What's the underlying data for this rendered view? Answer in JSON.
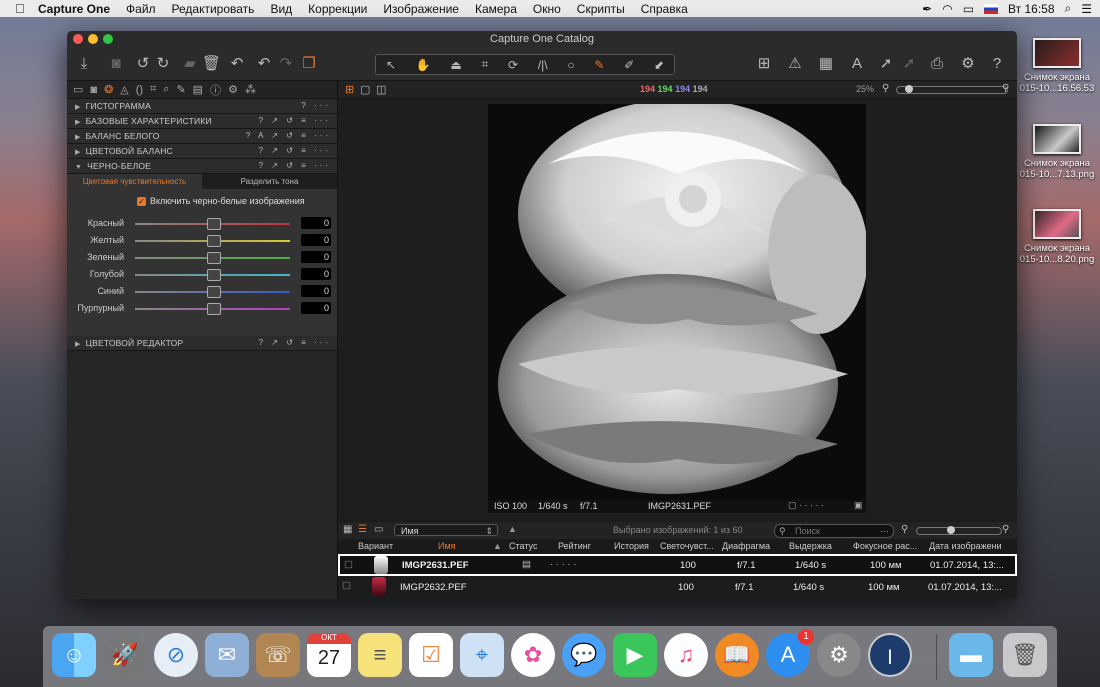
{
  "menubar": {
    "apple": "",
    "items": [
      "Capture One",
      "Файл",
      "Редактировать",
      "Вид",
      "Коррекции",
      "Изображение",
      "Камера",
      "Окно",
      "Скрипты",
      "Справка"
    ],
    "clock": "Вт 16:58"
  },
  "desktop": {
    "files": [
      {
        "label": "Снимок экрана\n015-10...16.56.53"
      },
      {
        "label": "Снимок экрана\n015-10...7.13.png"
      },
      {
        "label": "Снимок экрана\n015-10...8.20.png"
      }
    ]
  },
  "window": {
    "title": "Capture One Catalog"
  },
  "toolbar": {},
  "viewer": {
    "rgb": [
      "194",
      "194",
      "194",
      "194"
    ],
    "zoom": "25%"
  },
  "left": {
    "sections": [
      {
        "label": "ГИСТОГРАММА",
        "ctrls": "? ···"
      },
      {
        "label": "БАЗОВЫЕ ХАРАКТЕРИСТИКИ",
        "ctrls": "? ↗ ↺ ≡ ···"
      },
      {
        "label": "БАЛАНС БЕЛОГО",
        "ctrls": "? A ↗ ↺ ≡ ···"
      },
      {
        "label": "ЦВЕТОВОЙ БАЛАНС",
        "ctrls": "? ↗ ↺ ≡ ···"
      },
      {
        "label": "ЧЕРНО-БЕЛОЕ",
        "ctrls": "? ↗ ↺ ≡ ···"
      }
    ],
    "bw_tabs": [
      "Цветовая чувствительность",
      "Разделить тона"
    ],
    "enable_bw": "Включить черно-белые изображения",
    "sliders": [
      {
        "label": "Красный",
        "value": "0",
        "color": "#c0333a"
      },
      {
        "label": "Желтый",
        "value": "0",
        "color": "#d9c930"
      },
      {
        "label": "Зеленый",
        "value": "0",
        "color": "#4cae3f"
      },
      {
        "label": "Голубой",
        "value": "0",
        "color": "#3fb7c7"
      },
      {
        "label": "Синий",
        "value": "0",
        "color": "#3358c9"
      },
      {
        "label": "Пурпурный",
        "value": "0",
        "color": "#b53cc2"
      }
    ],
    "last_section": {
      "label": "ЦВЕТОВОЙ РЕДАКТОР",
      "ctrls": "? ↗ ↺ ≡ ···"
    }
  },
  "photo_info": {
    "iso": "ISO 100",
    "shutter": "1/640 s",
    "aperture": "f/7.1",
    "filename": "IMGP2631.PEF"
  },
  "browser": {
    "sort": "Имя",
    "selected": "Выбрано изображений: 1 из 60",
    "search_placeholder": "Поиск",
    "columns": [
      "Вариант",
      "Имя",
      "Статус",
      "Рейтинг",
      "История",
      "Светочувст...",
      "Диафрагма",
      "Выдержка",
      "Фокусное рас...",
      "Дата изображени"
    ],
    "rows": [
      {
        "name": "IMGP2631.PEF",
        "rating": "· · · · ·",
        "iso": "100",
        "aperture": "f/7.1",
        "shutter": "1/640 s",
        "focal": "100 мм",
        "date": "01.07.2014, 13:..."
      },
      {
        "name": "IMGP2632.PEF",
        "rating": "",
        "iso": "100",
        "aperture": "f/7.1",
        "shutter": "1/640 s",
        "focal": "100 мм",
        "date": "01.07.2014, 13:..."
      }
    ]
  },
  "dock": {
    "calendar_month": "ОКТ",
    "calendar_day": "27",
    "badge": "1"
  }
}
